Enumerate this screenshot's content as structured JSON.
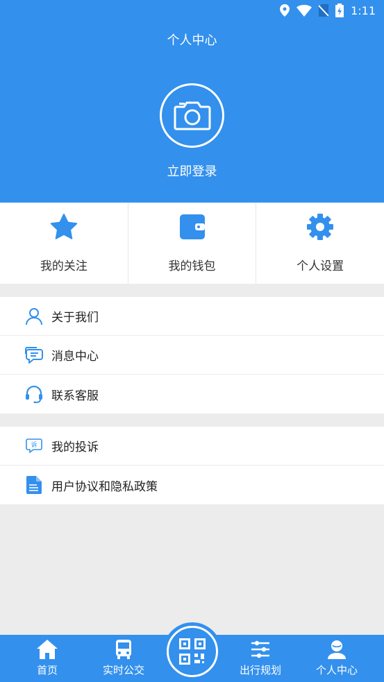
{
  "status_bar": {
    "time": "1:11"
  },
  "header": {
    "title": "个人中心",
    "login_label": "立即登录"
  },
  "quick_actions": [
    {
      "label": "我的关注",
      "icon": "star-icon"
    },
    {
      "label": "我的钱包",
      "icon": "wallet-icon"
    },
    {
      "label": "个人设置",
      "icon": "gear-icon"
    }
  ],
  "menu_group_1": [
    {
      "label": "关于我们",
      "icon": "user-outline-icon"
    },
    {
      "label": "消息中心",
      "icon": "chat-bubbles-icon"
    },
    {
      "label": "联系客服",
      "icon": "headset-icon"
    }
  ],
  "menu_group_2": [
    {
      "label": "我的投诉",
      "icon": "complaint-icon",
      "icon_text": "诉"
    },
    {
      "label": "用户协议和隐私政策",
      "icon": "document-icon"
    }
  ],
  "tab_bar": {
    "tabs": [
      {
        "label": "首页",
        "icon": "home-icon"
      },
      {
        "label": "实时公交",
        "icon": "bus-icon"
      },
      {
        "label": "出行规划",
        "icon": "sliders-icon"
      },
      {
        "label": "个人中心",
        "icon": "profile-icon"
      }
    ],
    "center_icon": "qr-code-icon"
  },
  "colors": {
    "primary": "#3390ed",
    "background": "#ececec",
    "text": "#222222"
  }
}
